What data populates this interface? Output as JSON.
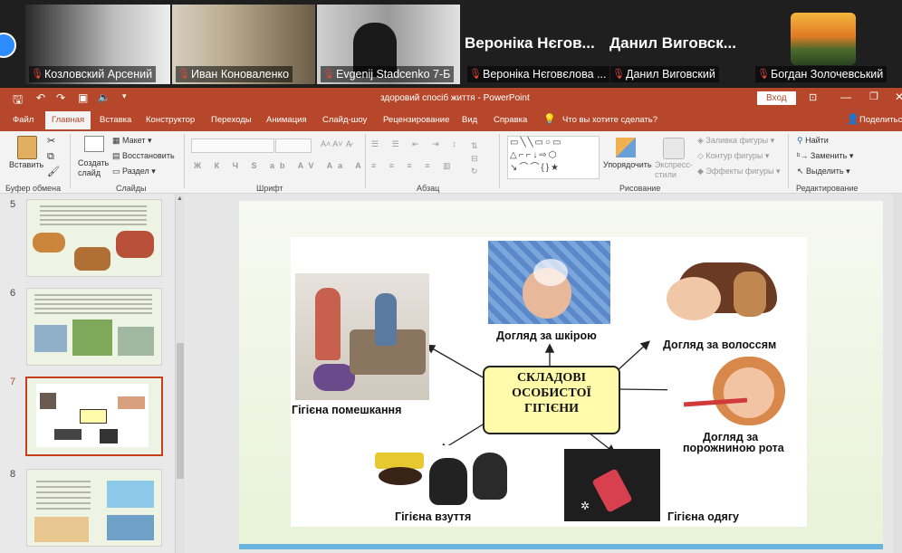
{
  "participants": {
    "tiles": [
      {
        "label": "Козловский Арсений"
      },
      {
        "label": "Иван Коноваленко"
      },
      {
        "label": "Evgenij Stadcenko 7-Б"
      },
      {
        "label": "Вероніка Нєговєлова ..."
      },
      {
        "label": "Данил Виговский"
      },
      {
        "label": "Богдан Золочевський"
      }
    ],
    "big_names": [
      "Вероніка Нєгов...",
      "Данил  Виговск..."
    ]
  },
  "window": {
    "title": "здоровий спосіб життя  -  PowerPoint",
    "login_label": "Вход"
  },
  "ribbon_tabs": {
    "file": "Файл",
    "home": "Главная",
    "insert": "Вставка",
    "design": "Конструктор",
    "transitions": "Переходы",
    "animation": "Анимация",
    "slideshow": "Слайд-шоу",
    "review": "Рецензирование",
    "view": "Вид",
    "help": "Справка",
    "tell_me": "Что вы хотите сделать?",
    "share": "Поделиться"
  },
  "ribbon": {
    "paste": "Вставить",
    "new_slide": "Создать слайд",
    "layout": "Макет",
    "reset": "Восстановить",
    "section": "Раздел",
    "arrange": "Упорядочить",
    "quick_styles": "Экспресс-стили",
    "shape_fill": "Заливка фигуры",
    "shape_outline": "Контур фигуры",
    "shape_effects": "Эффекты фигуры",
    "find": "Найти",
    "replace": "Заменить",
    "select": "Выделить",
    "groups": {
      "clipboard": "Буфер обмена",
      "slides": "Слайды",
      "font": "Шрифт",
      "paragraph": "Абзац",
      "drawing": "Рисование",
      "editing": "Редактирование"
    }
  },
  "thumbnails": [
    {
      "num": "5"
    },
    {
      "num": "6"
    },
    {
      "num": "7"
    },
    {
      "num": "8"
    }
  ],
  "slide": {
    "center_line1": "СКЛАДОВІ",
    "center_line2": "ОСОБИСТОЇ",
    "center_line3": "ГІГІЄНИ",
    "captions": {
      "home": "Гігієна помешкання",
      "skin": "Догляд за шкірою",
      "hair": "Догляд за волоссям",
      "mouth1": "Догляд за",
      "mouth2": "порожниною рота",
      "shoes": "Гігієна взуття",
      "clothes": "Гігієна одягу"
    }
  },
  "colors": {
    "accent": "#b7472a",
    "mic_muted": "#e0473b",
    "center_box": "#fffbaa"
  }
}
